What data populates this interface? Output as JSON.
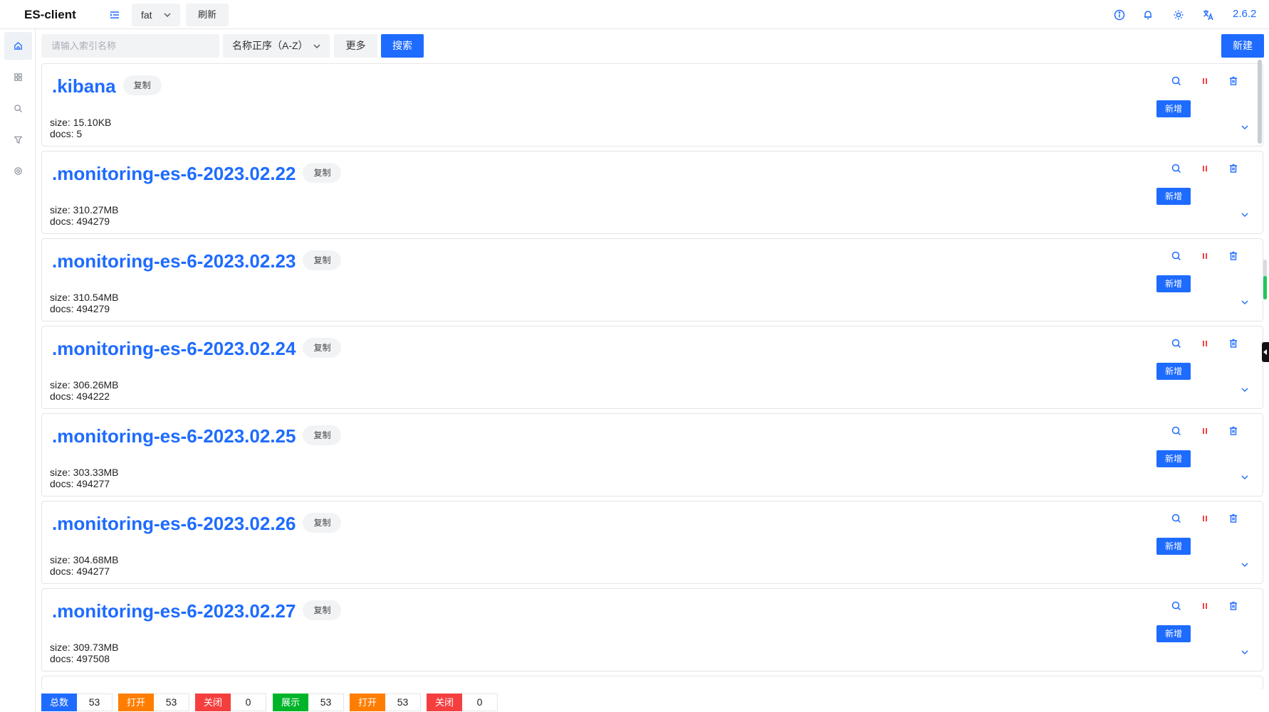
{
  "app": {
    "title": "ES-client",
    "version": "2.6.2"
  },
  "header": {
    "env_value": "fat",
    "refresh_label": "刷新",
    "icons": [
      "info-icon",
      "bell-icon",
      "settings-icon",
      "translate-icon"
    ]
  },
  "sidebar": {
    "items": [
      "home-icon",
      "grid-icon",
      "search-icon",
      "filter-icon",
      "settings-icon"
    ],
    "active": "home-icon"
  },
  "toolbar": {
    "search_placeholder": "请输入索引名称",
    "sort_value": "名称正序（A-Z）",
    "more_label": "更多",
    "search_label": "搜索",
    "new_label": "新建"
  },
  "cards": [
    {
      "name": ".kibana",
      "size": "size: 15.10KB",
      "docs": "docs: 5"
    },
    {
      "name": ".monitoring-es-6-2023.02.22",
      "size": "size: 310.27MB",
      "docs": "docs: 494279"
    },
    {
      "name": ".monitoring-es-6-2023.02.23",
      "size": "size: 310.54MB",
      "docs": "docs: 494279"
    },
    {
      "name": ".monitoring-es-6-2023.02.24",
      "size": "size: 306.26MB",
      "docs": "docs: 494222"
    },
    {
      "name": ".monitoring-es-6-2023.02.25",
      "size": "size: 303.33MB",
      "docs": "docs: 494277"
    },
    {
      "name": ".monitoring-es-6-2023.02.26",
      "size": "size: 304.68MB",
      "docs": "docs: 494277"
    },
    {
      "name": ".monitoring-es-6-2023.02.27",
      "size": "size: 309.73MB",
      "docs": "docs: 497508"
    }
  ],
  "card_labels": {
    "copy": "复制",
    "add": "新增"
  },
  "footer": {
    "stats": [
      {
        "label": "总数",
        "value": "53",
        "color": "#1e6bff"
      },
      {
        "label": "打开",
        "value": "53",
        "color": "#ff7d00"
      },
      {
        "label": "关闭",
        "value": "0",
        "color": "#f53f3f"
      },
      {
        "label": "展示",
        "value": "53",
        "color": "#00b42a"
      },
      {
        "label": "打开",
        "value": "53",
        "color": "#ff7d00"
      },
      {
        "label": "关闭",
        "value": "0",
        "color": "#f53f3f"
      }
    ]
  },
  "colors": {
    "accent": "#1e6bff",
    "danger": "#f53f3f"
  }
}
